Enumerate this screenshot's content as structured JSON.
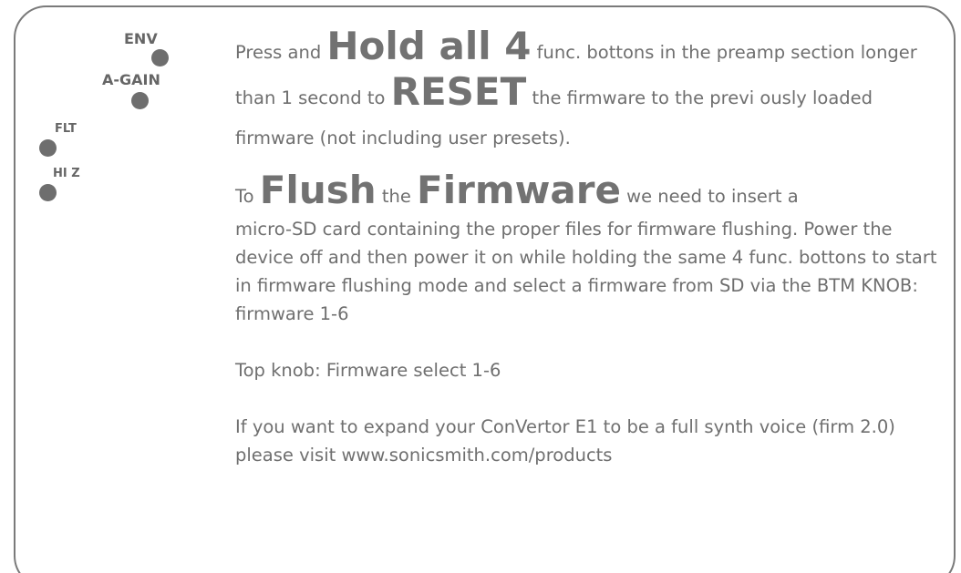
{
  "leds": {
    "env": "ENV",
    "a_gain": "A-GAIN",
    "flt": "FLT",
    "hi_z": "HI Z"
  },
  "reset_paragraph": {
    "t1": "Press and ",
    "big1": "Hold all 4",
    "t2": " func. bottons in the preamp section longer than 1 second to ",
    "big2": "RESET",
    "t3": " the firmware to the previ ously loaded firmware (not including user presets)."
  },
  "flush_paragraph": {
    "t1": "To ",
    "big1": "Flush",
    "t2": " the ",
    "big2": "Firmware",
    "t3": " we need to insert a",
    "body": "micro-SD card containing the proper files for firmware flushing. Power the device off and then power it on while holding the same 4 func. bottons to start in firmware flushing mode and select a firmware from SD via the BTM KNOB: firmware 1-6"
  },
  "top_knob_text": "Top knob: Firmware select 1-6",
  "expand_text": "If you want to expand your ConVertor E1 to be a full synth voice (firm 2.0) please visit www.sonicsmith.com/products"
}
